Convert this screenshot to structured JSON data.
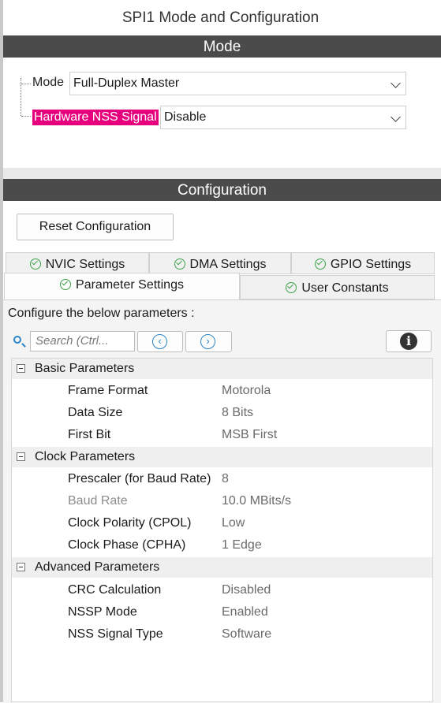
{
  "window": {
    "title": "SPI1 Mode and Configuration"
  },
  "mode_section": {
    "header": "Mode",
    "mode": {
      "label": "Mode",
      "value": "Full-Duplex Master"
    },
    "nss": {
      "label": "Hardware NSS Signal",
      "value": "Disable",
      "highlight_color": "#e6007e"
    }
  },
  "config_section": {
    "header": "Configuration",
    "reset_button": "Reset Configuration",
    "tabs_row1": [
      "NVIC Settings",
      "DMA Settings",
      "GPIO Settings"
    ],
    "tabs_row2": [
      "Parameter Settings",
      "User Constants"
    ],
    "active_tab": "Parameter Settings"
  },
  "params": {
    "instruction": "Configure the below parameters :",
    "search_placeholder": "Search (Ctrl...",
    "groups": [
      {
        "label": "Basic Parameters",
        "rows": [
          {
            "name": "Frame Format",
            "value": "Motorola"
          },
          {
            "name": "Data Size",
            "value": "8 Bits"
          },
          {
            "name": "First Bit",
            "value": "MSB First"
          }
        ]
      },
      {
        "label": "Clock Parameters",
        "rows": [
          {
            "name": "Prescaler (for Baud Rate)",
            "value": "8"
          },
          {
            "name": "Baud Rate",
            "value": "10.0 MBits/s",
            "disabled": true
          },
          {
            "name": "Clock Polarity (CPOL)",
            "value": "Low"
          },
          {
            "name": "Clock Phase (CPHA)",
            "value": "1 Edge"
          }
        ]
      },
      {
        "label": "Advanced Parameters",
        "rows": [
          {
            "name": "CRC Calculation",
            "value": "Disabled"
          },
          {
            "name": "NSSP Mode",
            "value": "Enabled"
          },
          {
            "name": "NSS Signal Type",
            "value": "Software"
          }
        ]
      }
    ]
  },
  "colors": {
    "header_bg": "#4b4b4b",
    "check_green": "#3ca24a",
    "accent_blue": "#2a83c6"
  }
}
